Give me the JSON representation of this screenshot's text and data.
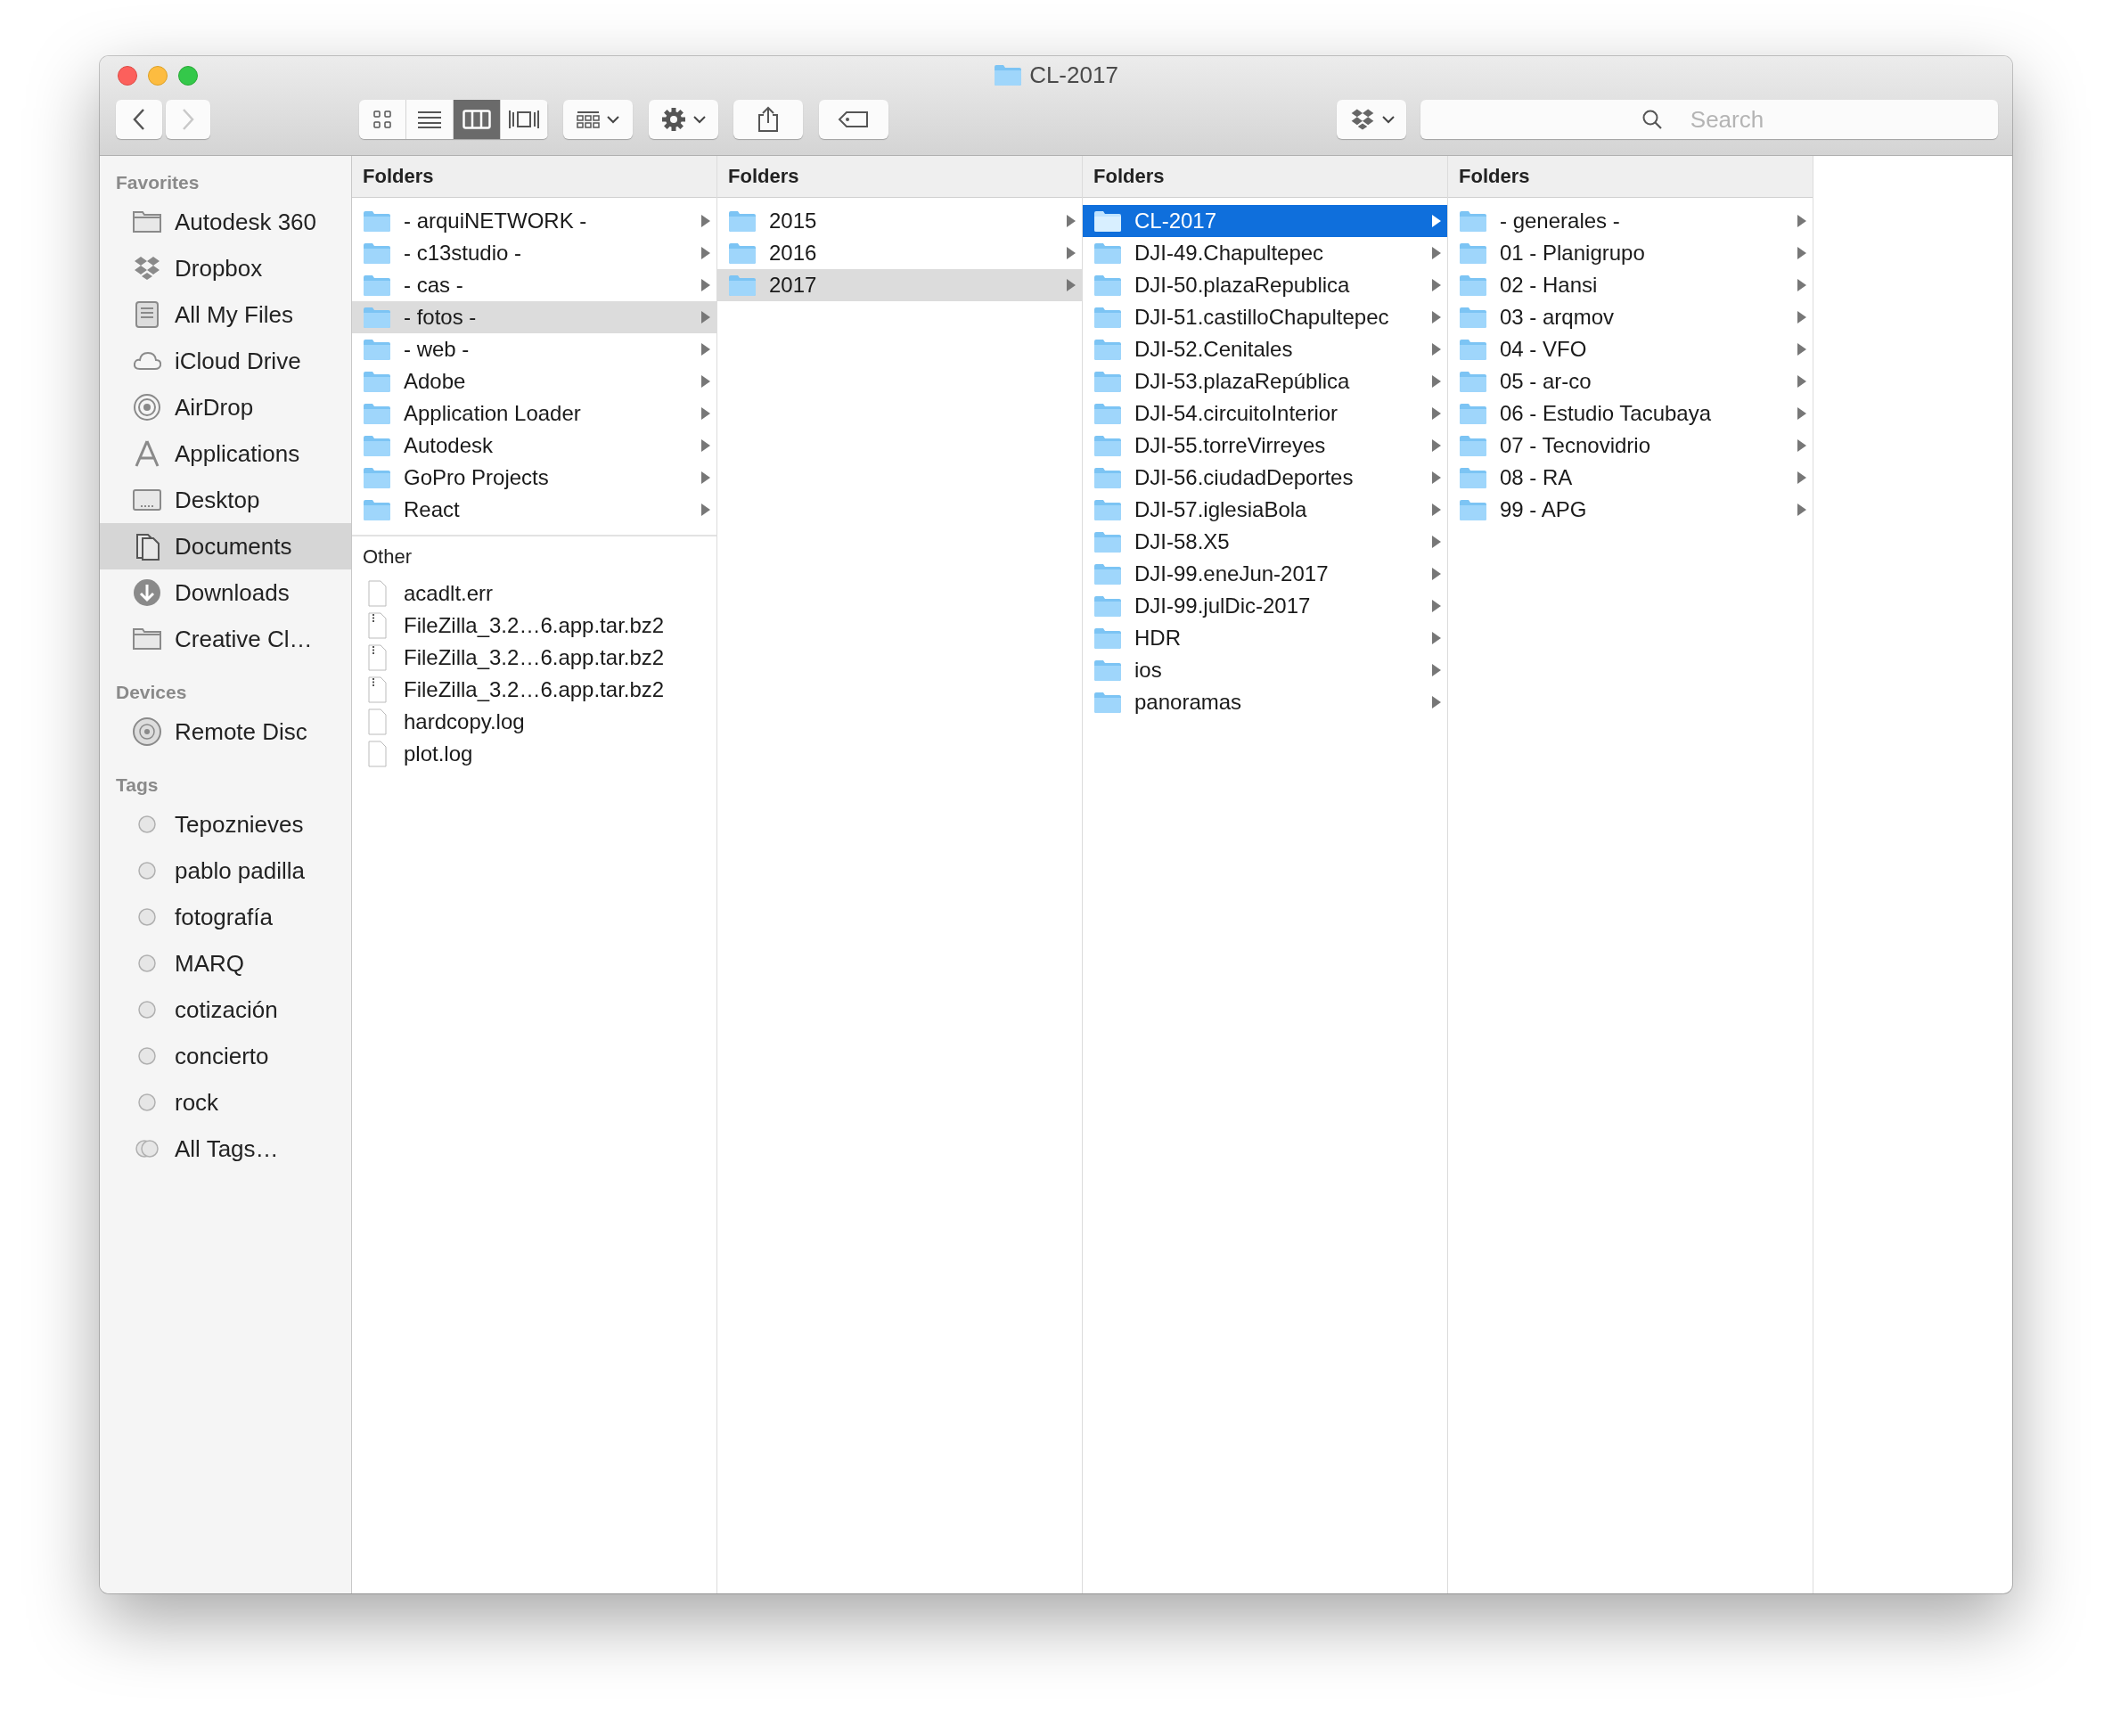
{
  "window": {
    "title": "CL-2017"
  },
  "toolbar": {
    "back": {
      "disabled": false
    },
    "forward": {
      "disabled": true
    },
    "view_modes": [
      {
        "kind": "icons",
        "selected": false
      },
      {
        "kind": "list",
        "selected": false
      },
      {
        "kind": "columns",
        "selected": true
      },
      {
        "kind": "coverflow",
        "selected": false
      }
    ],
    "search": {
      "placeholder": "Search"
    }
  },
  "sidebar": {
    "sections": [
      {
        "title": "Favorites",
        "items": [
          {
            "label": "Autodesk 360",
            "kind": "folder",
            "selected": false
          },
          {
            "label": "Dropbox",
            "kind": "dropbox",
            "selected": false
          },
          {
            "label": "All My Files",
            "kind": "files",
            "selected": false
          },
          {
            "label": "iCloud Drive",
            "kind": "cloud",
            "selected": false
          },
          {
            "label": "AirDrop",
            "kind": "airdrop",
            "selected": false
          },
          {
            "label": "Applications",
            "kind": "apps",
            "selected": false
          },
          {
            "label": "Desktop",
            "kind": "desktop",
            "selected": false
          },
          {
            "label": "Documents",
            "kind": "documents",
            "selected": true
          },
          {
            "label": "Downloads",
            "kind": "downloads",
            "selected": false
          },
          {
            "label": "Creative Cl…",
            "kind": "folder",
            "selected": false
          }
        ]
      },
      {
        "title": "Devices",
        "items": [
          {
            "label": "Remote Disc",
            "kind": "disc",
            "selected": false
          }
        ]
      },
      {
        "title": "Tags",
        "items": [
          {
            "label": "Tepoznieves",
            "kind": "tag",
            "selected": false
          },
          {
            "label": "pablo padilla",
            "kind": "tag",
            "selected": false
          },
          {
            "label": "fotografía",
            "kind": "tag",
            "selected": false
          },
          {
            "label": "MARQ",
            "kind": "tag",
            "selected": false
          },
          {
            "label": "cotización",
            "kind": "tag",
            "selected": false
          },
          {
            "label": "concierto",
            "kind": "tag",
            "selected": false
          },
          {
            "label": "rock",
            "kind": "tag",
            "selected": false
          },
          {
            "label": "All Tags…",
            "kind": "alltags",
            "selected": false
          }
        ]
      }
    ]
  },
  "columns": [
    {
      "focused": false,
      "sections": [
        {
          "header": "Folders",
          "items": [
            {
              "name": "- arquiNETWORK -",
              "kind": "folder",
              "selected": false
            },
            {
              "name": "- c13studio -",
              "kind": "folder",
              "selected": false
            },
            {
              "name": "- cas -",
              "kind": "folder",
              "selected": false
            },
            {
              "name": "- fotos -",
              "kind": "folder",
              "selected": true
            },
            {
              "name": "- web -",
              "kind": "folder",
              "selected": false
            },
            {
              "name": "Adobe",
              "kind": "folder",
              "selected": false
            },
            {
              "name": "Application Loader",
              "kind": "folder",
              "selected": false
            },
            {
              "name": "Autodesk",
              "kind": "folder",
              "selected": false
            },
            {
              "name": "GoPro Projects",
              "kind": "folder",
              "selected": false
            },
            {
              "name": "React",
              "kind": "folder",
              "selected": false
            }
          ]
        },
        {
          "header": "Other",
          "items": [
            {
              "name": "acadlt.err",
              "kind": "document",
              "selected": false
            },
            {
              "name": "FileZilla_3.2…6.app.tar.bz2",
              "kind": "archive",
              "selected": false
            },
            {
              "name": "FileZilla_3.2…6.app.tar.bz2",
              "kind": "archive",
              "selected": false
            },
            {
              "name": "FileZilla_3.2…6.app.tar.bz2",
              "kind": "archive",
              "selected": false
            },
            {
              "name": "hardcopy.log",
              "kind": "document",
              "selected": false
            },
            {
              "name": "plot.log",
              "kind": "document",
              "selected": false
            }
          ]
        }
      ]
    },
    {
      "focused": false,
      "sections": [
        {
          "header": "Folders",
          "items": [
            {
              "name": "2015",
              "kind": "folder",
              "selected": false
            },
            {
              "name": "2016",
              "kind": "folder",
              "selected": false
            },
            {
              "name": "2017",
              "kind": "folder",
              "selected": true
            }
          ]
        }
      ]
    },
    {
      "focused": true,
      "sections": [
        {
          "header": "Folders",
          "items": [
            {
              "name": "CL-2017",
              "kind": "folder",
              "selected": true
            },
            {
              "name": "DJI-49.Chapultepec",
              "kind": "folder",
              "selected": false
            },
            {
              "name": "DJI-50.plazaRepublica",
              "kind": "folder",
              "selected": false
            },
            {
              "name": "DJI-51.castilloChapultepec",
              "kind": "folder",
              "selected": false
            },
            {
              "name": "DJI-52.Cenitales",
              "kind": "folder",
              "selected": false
            },
            {
              "name": "DJI-53.plazaRepública",
              "kind": "folder",
              "selected": false
            },
            {
              "name": "DJI-54.circuitoInterior",
              "kind": "folder",
              "selected": false
            },
            {
              "name": "DJI-55.torreVirreyes",
              "kind": "folder",
              "selected": false
            },
            {
              "name": "DJI-56.ciudadDeportes",
              "kind": "folder",
              "selected": false
            },
            {
              "name": "DJI-57.iglesiaBola",
              "kind": "folder",
              "selected": false
            },
            {
              "name": "DJI-58.X5",
              "kind": "folder",
              "selected": false
            },
            {
              "name": "DJI-99.eneJun-2017",
              "kind": "folder",
              "selected": false
            },
            {
              "name": "DJI-99.julDic-2017",
              "kind": "folder",
              "selected": false
            },
            {
              "name": "HDR",
              "kind": "folder",
              "selected": false
            },
            {
              "name": "ios",
              "kind": "folder",
              "selected": false
            },
            {
              "name": "panoramas",
              "kind": "folder",
              "selected": false
            }
          ]
        }
      ]
    },
    {
      "sections": [
        {
          "header": "Folders",
          "items": [
            {
              "name": "- generales -",
              "kind": "folder",
              "selected": false
            },
            {
              "name": "01 - Planigrupo",
              "kind": "folder",
              "selected": false
            },
            {
              "name": "02 - Hansi",
              "kind": "folder",
              "selected": false
            },
            {
              "name": "03 - arqmov",
              "kind": "folder",
              "selected": false
            },
            {
              "name": "04 - VFO",
              "kind": "folder",
              "selected": false
            },
            {
              "name": "05 - ar-co",
              "kind": "folder",
              "selected": false
            },
            {
              "name": "06 - Estudio Tacubaya",
              "kind": "folder",
              "selected": false
            },
            {
              "name": "07 - Tecnovidrio",
              "kind": "folder",
              "selected": false
            },
            {
              "name": "08 - RA",
              "kind": "folder",
              "selected": false
            },
            {
              "name": "99 - APG",
              "kind": "folder",
              "selected": false
            }
          ]
        }
      ]
    }
  ]
}
